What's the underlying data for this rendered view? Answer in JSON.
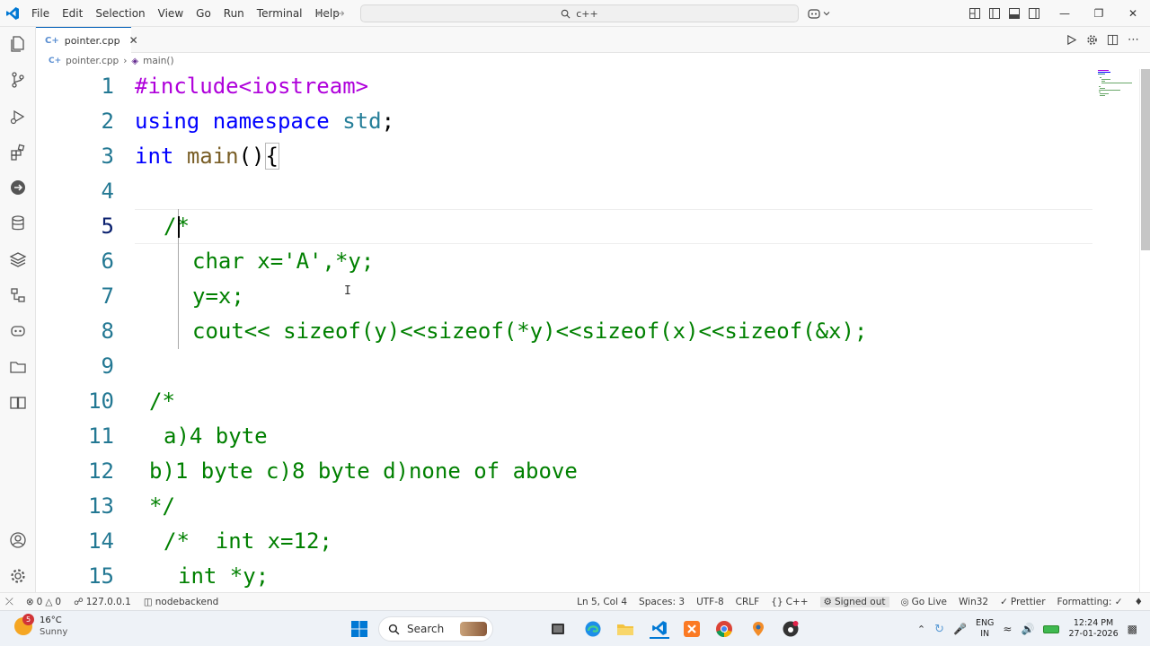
{
  "menu": [
    "File",
    "Edit",
    "Selection",
    "View",
    "Go",
    "Run",
    "Terminal",
    "Help"
  ],
  "command_center": {
    "text": "c++"
  },
  "tab": {
    "label": "pointer.cpp"
  },
  "breadcrumb": {
    "file": "pointer.cpp",
    "symbol": "main()"
  },
  "editor": {
    "cursor_line": 5,
    "lines": [
      {
        "no": "1",
        "text": "#include<iostream>"
      },
      {
        "no": "2",
        "text": "using namespace std;"
      },
      {
        "no": "3",
        "text": "int main(){"
      },
      {
        "no": "4",
        "text": ""
      },
      {
        "no": "5",
        "text": "/*"
      },
      {
        "no": "6",
        "text": "char x='A',*y;"
      },
      {
        "no": "7",
        "text": "y=x;"
      },
      {
        "no": "8",
        "text": "cout<< sizeof(y)<<sizeof(*y)<<sizeof(x)<<sizeof(&x);"
      },
      {
        "no": "9",
        "text": ""
      },
      {
        "no": "10",
        "text": "/*"
      },
      {
        "no": "11",
        "text": "a)4 byte"
      },
      {
        "no": "12",
        "text": "b)1 byte c)8 byte d)none of above"
      },
      {
        "no": "13",
        "text": "*/"
      },
      {
        "no": "14",
        "text": "/*  int x=12;"
      },
      {
        "no": "15",
        "text": "int *y;"
      }
    ]
  },
  "statusbar": {
    "errors": "0",
    "warnings": "0",
    "remote": "127.0.0.1",
    "db": "nodebackend",
    "position": "Ln 5, Col 4",
    "spaces": "Spaces: 3",
    "encoding": "UTF-8",
    "eol": "CRLF",
    "language": "C++",
    "account": "Signed out",
    "golive": "Go Live",
    "platform": "Win32",
    "prettier": "Prettier",
    "formatting": "Formatting: ✓"
  },
  "taskbar": {
    "weather_temp": "16°C",
    "weather_desc": "Sunny",
    "weather_badge": "5",
    "search": "Search",
    "lang": "ENG",
    "region": "IN",
    "time": "12:24 PM",
    "date": "27-01-2026"
  },
  "colors": {
    "accent": "#005fb8",
    "keyword": "#0000ff",
    "preprocessor": "#af00db",
    "type": "#267f99",
    "function": "#795e26",
    "comment": "#008000",
    "line_number": "#237893"
  }
}
